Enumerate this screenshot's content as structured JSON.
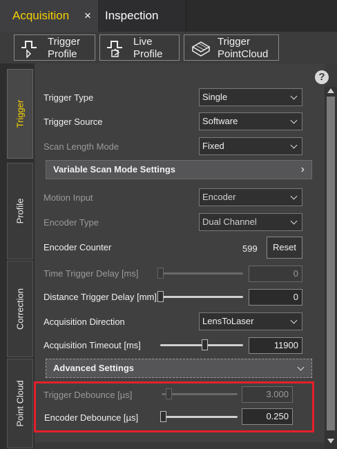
{
  "tabs": {
    "acquisition": "Acquisition",
    "close": "×",
    "inspection": "Inspection"
  },
  "toolbar": {
    "trigger_profile": [
      "Trigger",
      "Profile"
    ],
    "live_profile": [
      "Live",
      "Profile"
    ],
    "trigger_pointcloud": [
      "Trigger",
      "PointCloud"
    ]
  },
  "side_tabs": {
    "trigger": "Trigger",
    "profile": "Profile",
    "correction": "Correction",
    "point_cloud": "Point Cloud"
  },
  "help": "?",
  "fields": {
    "trigger_type": {
      "label": "Trigger Type",
      "value": "Single"
    },
    "trigger_source": {
      "label": "Trigger Source",
      "value": "Software"
    },
    "scan_length_mode": {
      "label": "Scan Length Mode",
      "value": "Fixed"
    },
    "motion_input": {
      "label": "Motion Input",
      "value": "Encoder"
    },
    "encoder_type": {
      "label": "Encoder Type",
      "value": "Dual Channel"
    },
    "encoder_counter": {
      "label": "Encoder Counter",
      "value": "599",
      "button": "Reset"
    },
    "time_trigger_delay": {
      "label": "Time Trigger Delay [ms]",
      "value": "0"
    },
    "distance_trigger_delay": {
      "label": "Distance Trigger Delay [mm]",
      "value": "0"
    },
    "acquisition_direction": {
      "label": "Acquisition Direction",
      "value": "LensToLaser"
    },
    "acquisition_timeout": {
      "label": "Acquisition Timeout [ms]",
      "value": "11900"
    },
    "trigger_debounce": {
      "label": "Trigger Debounce [µs]",
      "value": "3.000"
    },
    "encoder_debounce": {
      "label": "Encoder Debounce [µs]",
      "value": "0.250"
    }
  },
  "sections": {
    "variable_scan": "Variable Scan Mode Settings",
    "variable_scan_arrow": "›",
    "advanced": "Advanced Settings"
  },
  "colors": {
    "active_tab_text": "#f5d000",
    "highlight_border": "#e5202a",
    "panel_bg": "#404040"
  }
}
